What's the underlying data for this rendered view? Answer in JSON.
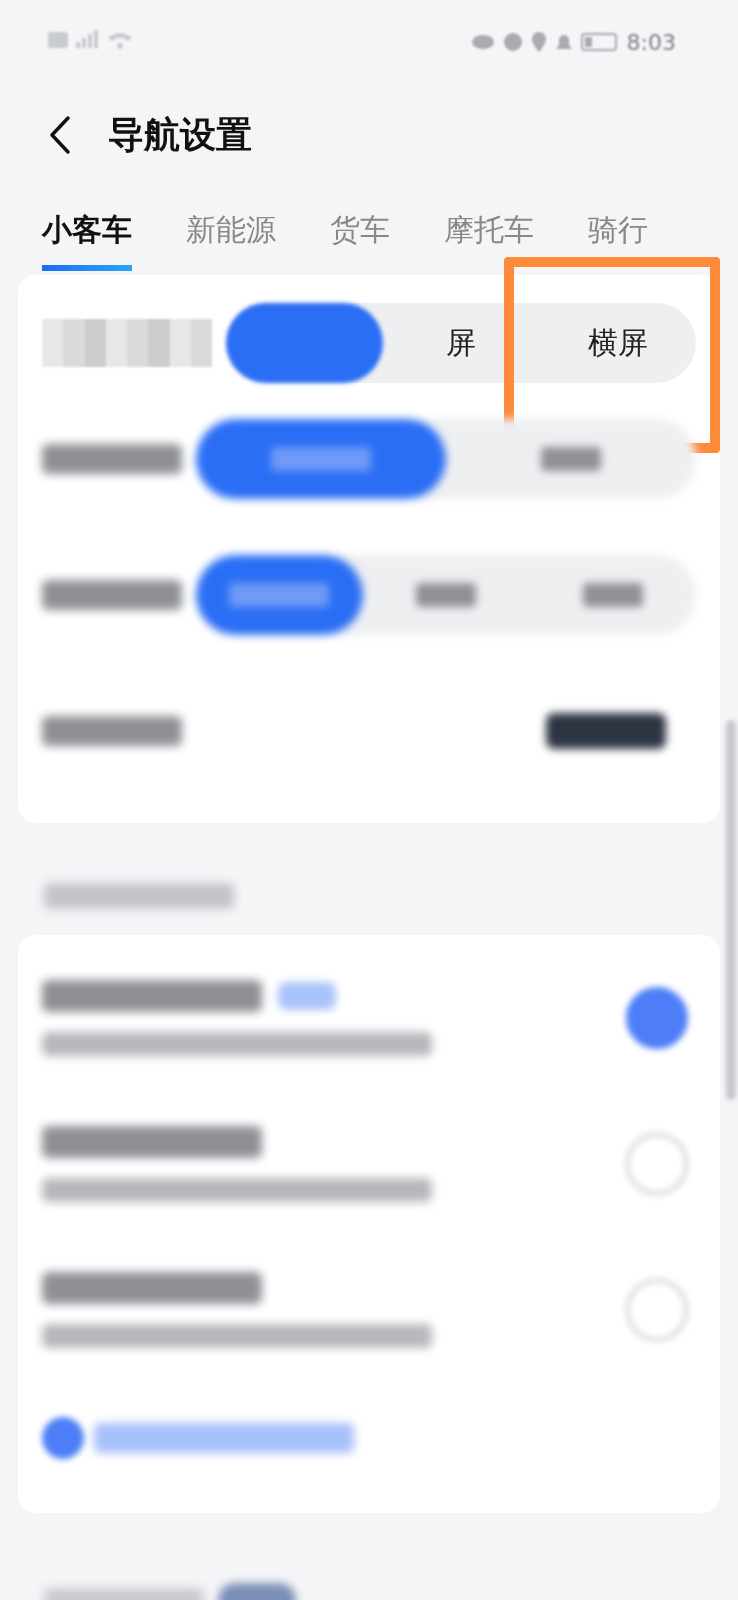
{
  "status_bar": {
    "time": "8:03"
  },
  "header": {
    "title": "导航设置"
  },
  "tabs": [
    {
      "label": "小客车",
      "selected": true
    },
    {
      "label": "新能源",
      "selected": false
    },
    {
      "label": "货车",
      "selected": false
    },
    {
      "label": "摩托车",
      "selected": false
    },
    {
      "label": "骑行",
      "selected": false
    }
  ],
  "orientation_row": {
    "segments": [
      {
        "selected": true
      },
      {
        "label": "屏",
        "selected": false
      },
      {
        "label": "横屏",
        "selected": false,
        "highlighted": true
      }
    ]
  },
  "blurred_rows": [
    {
      "kind": "segmented",
      "segments": [
        {
          "selected": true
        },
        {
          "selected": false
        }
      ]
    },
    {
      "kind": "segmented",
      "segments": [
        {
          "selected": true
        },
        {
          "selected": false
        },
        {
          "selected": false
        }
      ]
    },
    {
      "kind": "preview"
    }
  ],
  "radio_rows": [
    {
      "badge": true,
      "checked": true
    },
    {
      "badge": false,
      "checked": false
    },
    {
      "badge": false,
      "checked": false
    }
  ]
}
